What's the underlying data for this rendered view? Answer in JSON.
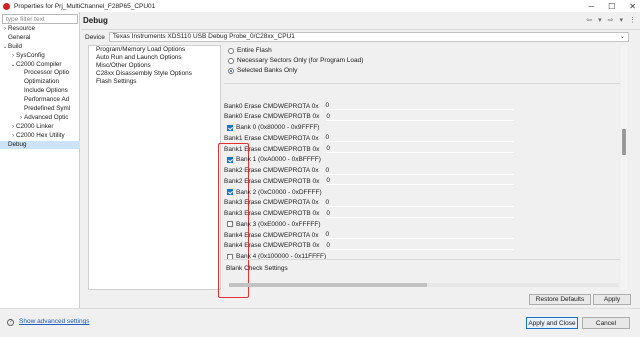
{
  "window": {
    "title": "Properties for Prj_MultiChannel_F28P65_CPU01",
    "controls": [
      "─",
      "☐",
      "✕"
    ]
  },
  "filter": {
    "placeholder": "type filter text"
  },
  "tree": [
    {
      "label": "Resource",
      "chev": "›",
      "indent": 0
    },
    {
      "label": "General",
      "chev": "",
      "indent": 0
    },
    {
      "label": "Build",
      "chev": "⌄",
      "indent": 0
    },
    {
      "label": "SysConfig",
      "chev": "›",
      "indent": 1
    },
    {
      "label": "C2000 Compiler",
      "chev": "⌄",
      "indent": 1
    },
    {
      "label": "Processor Optio",
      "chev": "",
      "indent": 2
    },
    {
      "label": "Optimization",
      "chev": "",
      "indent": 2
    },
    {
      "label": "Include Options",
      "chev": "",
      "indent": 2
    },
    {
      "label": "Performance Ad",
      "chev": "",
      "indent": 2
    },
    {
      "label": "Predefined Syml",
      "chev": "",
      "indent": 2
    },
    {
      "label": "Advanced Optic",
      "chev": "›",
      "indent": 2
    },
    {
      "label": "C2000 Linker",
      "chev": "›",
      "indent": 1
    },
    {
      "label": "C2000 Hex Utility",
      "chev": "›",
      "indent": 1
    },
    {
      "label": "Debug",
      "chev": "",
      "indent": 0,
      "selected": true
    }
  ],
  "header": {
    "title": "Debug",
    "icons": [
      "⇦",
      "▾",
      "⇨",
      "▾",
      "⋮"
    ]
  },
  "device": {
    "label": "Device",
    "value": "Texas Instruments XDS110 USB Debug Probe_0/C28xx_CPU1",
    "dropdown": "⌄"
  },
  "categories": [
    "Program/Memory Load Options",
    "Auto Run and Launch Options",
    "Misc/Other Options",
    "C28xx Disassembly Style Options",
    "Flash Settings"
  ],
  "erase_options": [
    {
      "label": "Entire Flash",
      "selected": false
    },
    {
      "label": "Necessary Sectors Only (for Program Load)",
      "selected": false
    },
    {
      "label": "Selected Banks Only",
      "selected": true
    }
  ],
  "bank_rows": [
    {
      "kind": "field",
      "label": "Bank0 Erase CMDWEPROTA 0x",
      "value": "0"
    },
    {
      "kind": "field",
      "label": "Bank0 Erase CMDWEPROTB 0x",
      "value": "0"
    },
    {
      "kind": "check",
      "label": "Bank 0 (0x80000 - 0x9FFFF)",
      "checked": true
    },
    {
      "kind": "field",
      "label": "Bank1 Erase CMDWEPROTA 0x",
      "value": "0"
    },
    {
      "kind": "field",
      "label": "Bank1 Erase CMDWEPROTB 0x",
      "value": "0"
    },
    {
      "kind": "check",
      "label": "Bank 1 (0xA0000 - 0xBFFFF)",
      "checked": true
    },
    {
      "kind": "field",
      "label": "Bank2 Erase CMDWEPROTA 0x",
      "value": "0"
    },
    {
      "kind": "field",
      "label": "Bank2 Erase CMDWEPROTB 0x",
      "value": "0"
    },
    {
      "kind": "check",
      "label": "Bank 2 (0xC0000 - 0xDFFFF)",
      "checked": true
    },
    {
      "kind": "field",
      "label": "Bank3 Erase CMDWEPROTA 0x",
      "value": "0"
    },
    {
      "kind": "field",
      "label": "Bank3 Erase CMDWEPROTB 0x",
      "value": "0"
    },
    {
      "kind": "check",
      "label": "Bank 3 (0xE0000 - 0xFFFFF)",
      "checked": false
    },
    {
      "kind": "field",
      "label": "Bank4 Erase CMDWEPROTA 0x",
      "value": "0"
    },
    {
      "kind": "field",
      "label": "Bank4 Erase CMDWEPROTB 0x",
      "value": "0"
    },
    {
      "kind": "check",
      "label": "Bank 4 (0x100000 - 0x11FFFF)",
      "checked": false
    }
  ],
  "blank_check": "Blank Check Settings",
  "buttons": {
    "restore_defaults": "Restore Defaults",
    "apply": "Apply",
    "apply_and_close": "Apply and Close",
    "cancel": "Cancel"
  },
  "footer": {
    "help_icon": "?",
    "advanced_link": "Show advanced settings"
  },
  "colors": {
    "selection": "#cde3f7",
    "checkbox_checked": "#1a73c9",
    "highlight_annotation": "#e53030",
    "link": "#1f5fbf"
  }
}
